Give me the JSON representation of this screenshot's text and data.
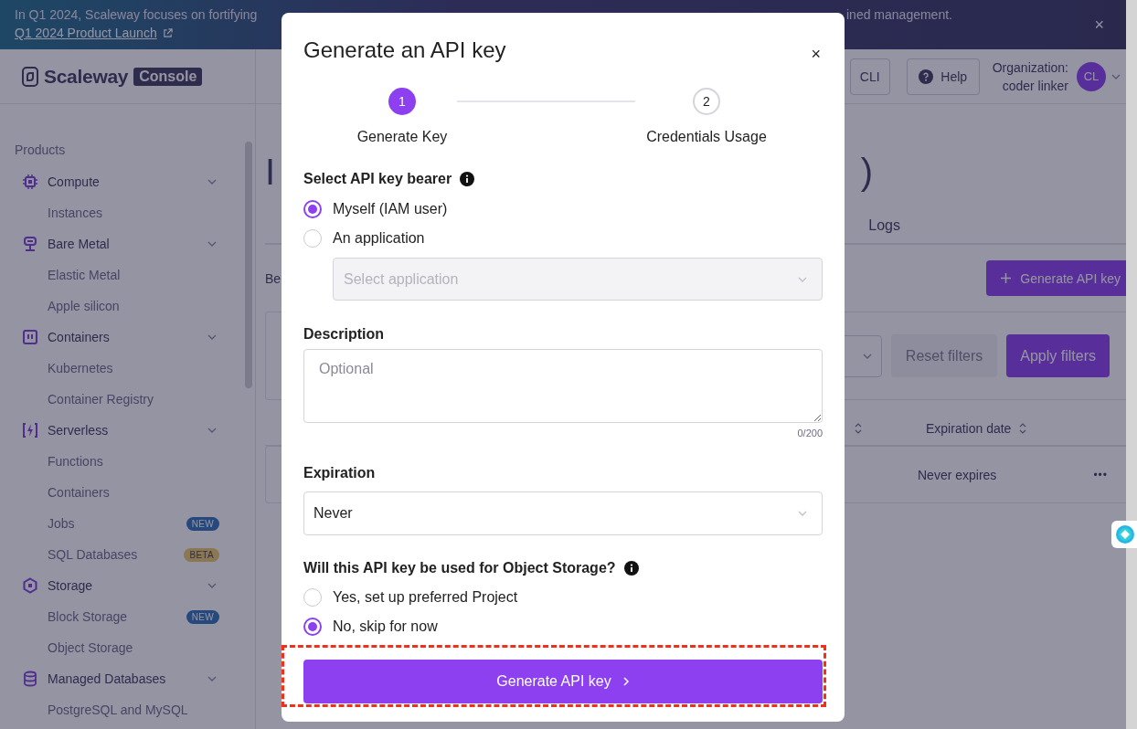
{
  "banner": {
    "text": "In Q1 2024, Scaleway focuses on fortifying",
    "link": "Q1 2024 Product Launch",
    "text_end": "ined management.",
    "close": "×"
  },
  "sidebar": {
    "logo": {
      "name": "Scaleway",
      "badge": "Console"
    },
    "heading": "Products",
    "groups": [
      {
        "label": "Compute",
        "expanded": true,
        "children": [
          {
            "label": "Instances"
          }
        ]
      },
      {
        "label": "Bare Metal",
        "expanded": true,
        "children": [
          {
            "label": "Elastic Metal"
          },
          {
            "label": "Apple silicon"
          }
        ]
      },
      {
        "label": "Containers",
        "expanded": true,
        "children": [
          {
            "label": "Kubernetes"
          },
          {
            "label": "Container Registry"
          }
        ]
      },
      {
        "label": "Serverless",
        "expanded": true,
        "children": [
          {
            "label": "Functions"
          },
          {
            "label": "Containers"
          },
          {
            "label": "Jobs",
            "badge": {
              "text": "NEW",
              "kind": "new"
            }
          },
          {
            "label": "SQL Databases",
            "badge": {
              "text": "BETA",
              "kind": "beta"
            }
          }
        ]
      },
      {
        "label": "Storage",
        "expanded": true,
        "children": [
          {
            "label": "Block Storage",
            "badge": {
              "text": "NEW",
              "kind": "new"
            }
          },
          {
            "label": "Object Storage"
          }
        ]
      },
      {
        "label": "Managed Databases",
        "expanded": true,
        "children": [
          {
            "label": "PostgreSQL and MySQL"
          }
        ]
      }
    ]
  },
  "header": {
    "cli_button": "CLI",
    "help_button": "Help",
    "organization_label": "Organization:",
    "organization_name": "coder linker",
    "avatar": "CL"
  },
  "page": {
    "title_start": "I",
    "title_end": ")",
    "tabs": [
      {
        "label": "Logs",
        "selected": false
      }
    ],
    "intro": "Be",
    "generate_button": "Generate API key",
    "filters": {
      "reset_button": "Reset filters",
      "reset_disabled": true,
      "apply_button": "Apply filters"
    },
    "table": {
      "columns": [
        "Expiration date"
      ],
      "rows": [
        {
          "expiration": "Never expires",
          "menu": "•••"
        }
      ]
    }
  },
  "modal": {
    "title": "Generate an API key",
    "close": "×",
    "steps": [
      {
        "number": "1",
        "label": "Generate Key",
        "active": true
      },
      {
        "number": "2",
        "label": "Credentials Usage",
        "active": false
      }
    ],
    "bearer": {
      "label": "Select API key bearer",
      "options": [
        {
          "label": "Myself (IAM user)",
          "selected": true
        },
        {
          "label": "An application",
          "selected": false
        }
      ],
      "application_select": {
        "placeholder": "Select application",
        "disabled": true
      }
    },
    "description": {
      "label": "Description",
      "placeholder": "Optional",
      "counter": "0/200"
    },
    "expiration": {
      "label": "Expiration",
      "value": "Never"
    },
    "object_storage": {
      "label": "Will this API key be used for Object Storage?",
      "options": [
        {
          "label": "Yes, set up preferred Project",
          "selected": false
        },
        {
          "label": "No, skip for now",
          "selected": true
        }
      ]
    },
    "submit": {
      "label": "Generate API key",
      "highlighted": true
    }
  }
}
